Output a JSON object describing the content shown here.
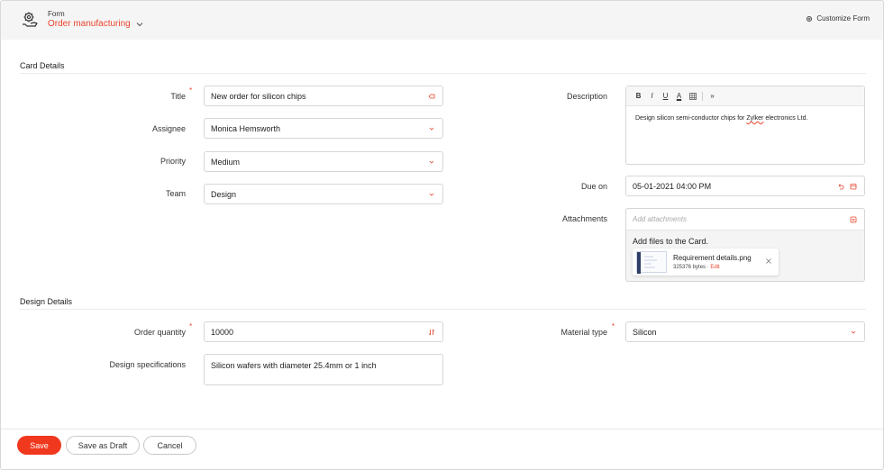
{
  "header": {
    "form_small": "Form",
    "form_name": "Order manufacturing",
    "customize_label": "Customize Form"
  },
  "sections": {
    "card_details": "Card Details",
    "design_details": "Design Details"
  },
  "fields": {
    "title": {
      "label": "Title",
      "value": "New order for silicon chips",
      "required": true
    },
    "assignee": {
      "label": "Assignee",
      "value": "Monica Hemsworth"
    },
    "priority": {
      "label": "Priority",
      "value": "Medium"
    },
    "team": {
      "label": "Team",
      "value": "Design"
    },
    "description": {
      "label": "Description",
      "text_before": "Design silicon semi-conductor chips for ",
      "text_misspelled": "Zylker",
      "text_after": " electronics Ltd.",
      "toolbar": {
        "bold": "B",
        "italic": "I",
        "underline": "U",
        "font_color": "A",
        "more": "»"
      }
    },
    "due_on": {
      "label": "Due on",
      "value": "05-01-2021 04:00 PM"
    },
    "attachments": {
      "label": "Attachments",
      "placeholder": "Add attachments",
      "hint": "Add files to the Card.",
      "file": {
        "name": "Requirement details.png",
        "size": "325376 bytes",
        "edit": "Edit"
      }
    },
    "order_quantity": {
      "label": "Order quantity",
      "value": "10000",
      "required": true
    },
    "material_type": {
      "label": "Material type",
      "value": "Silicon",
      "required": true
    },
    "design_specifications": {
      "label": "Design specifications",
      "value": "Silicon wafers with diameter 25.4mm or 1 inch"
    }
  },
  "footer": {
    "save": "Save",
    "save_draft": "Save as Draft",
    "cancel": "Cancel"
  },
  "colors": {
    "accent": "#e8442c",
    "save_button": "#f0381f",
    "header_bg": "#f5f5f5"
  }
}
